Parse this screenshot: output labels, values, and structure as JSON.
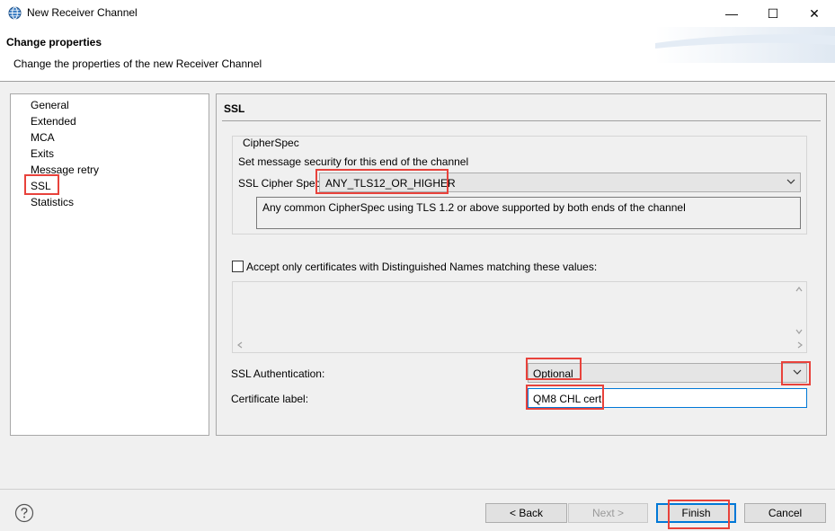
{
  "window": {
    "title": "New Receiver Channel",
    "minimize_glyph": "—",
    "maximize_glyph": "☐",
    "close_glyph": "✕"
  },
  "header": {
    "title": "Change properties",
    "description": "Change the properties of the new Receiver Channel"
  },
  "nav": {
    "items": [
      {
        "label": "General"
      },
      {
        "label": "Extended"
      },
      {
        "label": "MCA"
      },
      {
        "label": "Exits"
      },
      {
        "label": "Message retry"
      },
      {
        "label": "SSL"
      },
      {
        "label": "Statistics"
      }
    ],
    "selected": "SSL"
  },
  "ssl": {
    "section_title": "SSL",
    "cipher_group": {
      "legend": "CipherSpec",
      "instruction": "Set message security for this end of the channel",
      "cipher_label": "SSL Cipher Spec:",
      "cipher_value": "ANY_TLS12_OR_HIGHER",
      "cipher_description": "Any common CipherSpec using TLS 1.2 or above supported by both ends of the channel"
    },
    "dn_checkbox_label": "Accept only certificates with Distinguished Names matching these values:",
    "dn_checked": false,
    "auth_label": "SSL Authentication:",
    "auth_value": "Optional",
    "cert_label": "Certificate label:",
    "cert_value": "QM8 CHL cert"
  },
  "buttons": {
    "back": "< Back",
    "next": "Next >",
    "finish": "Finish",
    "cancel": "Cancel"
  },
  "icons": {
    "app": "globe-icon",
    "help": "help-icon"
  },
  "colors": {
    "highlight": "#e8423b",
    "focus_border": "#0078d7"
  }
}
